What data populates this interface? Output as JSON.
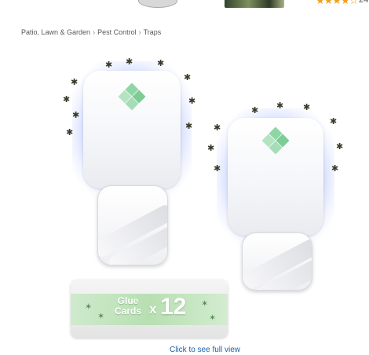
{
  "top_strip": {
    "rating_stars": "★★★★☆",
    "review_count_partial": "24"
  },
  "breadcrumb": {
    "items": [
      "Patio, Lawn & Garden",
      "Pest Control",
      "Traps"
    ],
    "separator": "›"
  },
  "product_image": {
    "glue_cards": {
      "label_line1": "Glue",
      "label_line2": "Cards",
      "multiplier": "x",
      "count": "12"
    }
  },
  "full_view_link": "Click to see full view",
  "colors": {
    "link": "#1a5fa8",
    "breadcrumb": "#565959",
    "glow": "#7896ff",
    "logo_green": "#8fd6a6"
  }
}
